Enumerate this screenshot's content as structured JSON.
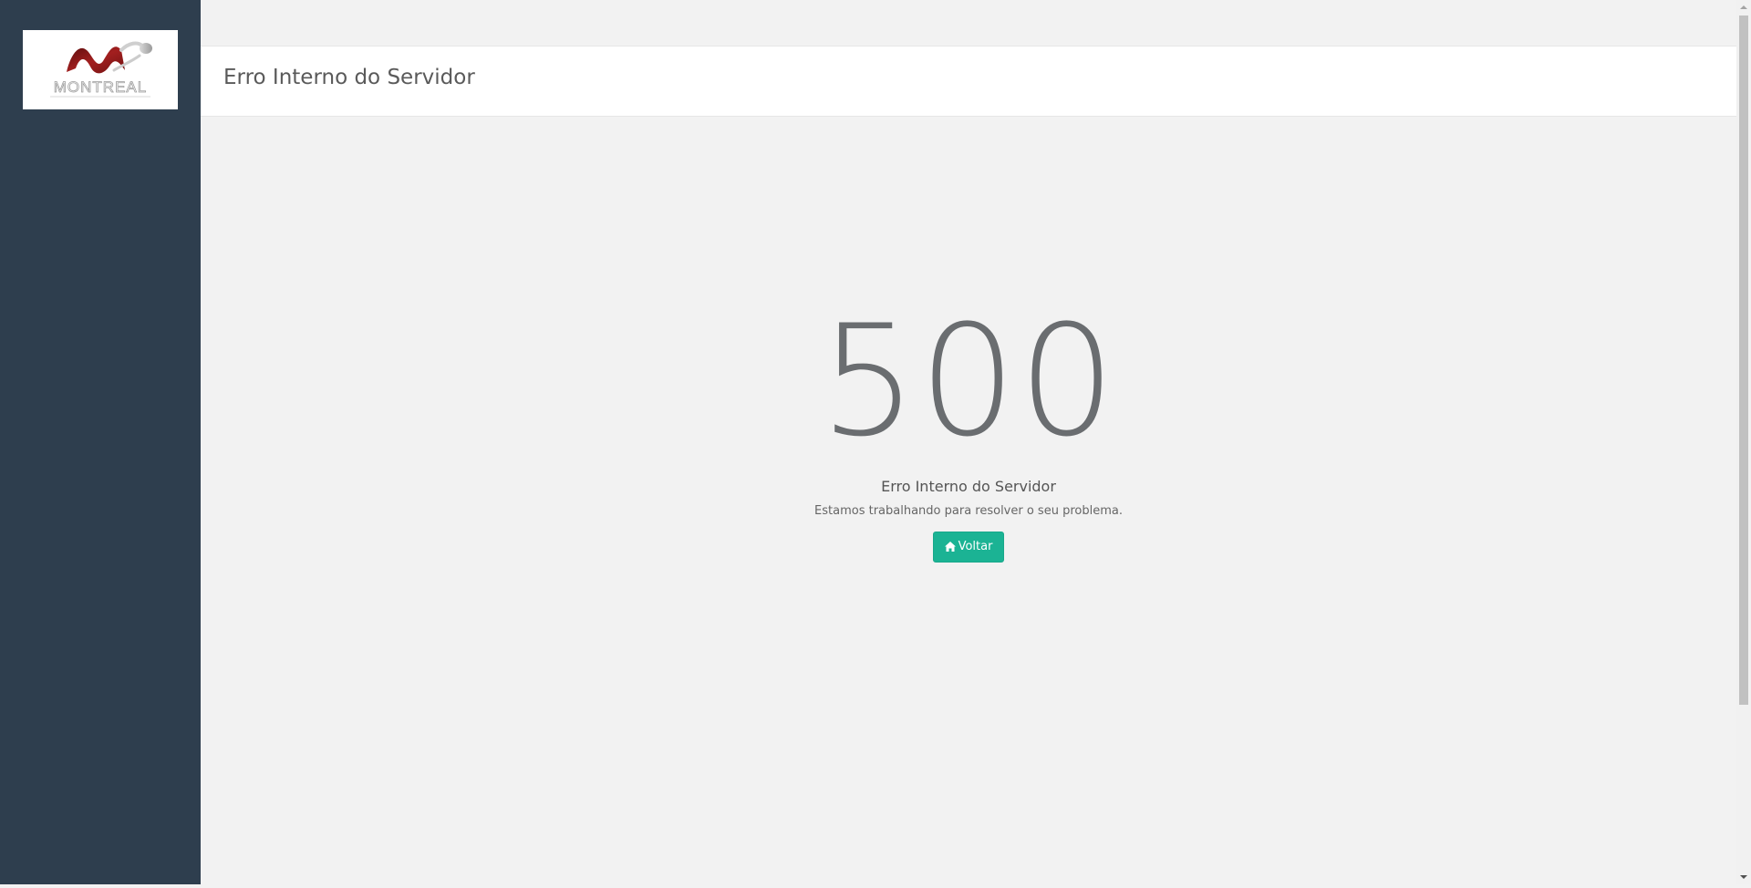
{
  "sidebar": {
    "logo": {
      "icon": "montreal-logo",
      "text": "MONTREAL",
      "colors": {
        "primary": "#8b1a1a",
        "secondary": "#b8b8b8"
      }
    }
  },
  "header": {
    "title": "Erro Interno do Servidor"
  },
  "error": {
    "code": "500",
    "heading": "Erro Interno do Servidor",
    "message": "Estamos trabalhando para resolver o seu problema.",
    "back_button": {
      "label": "Voltar",
      "icon": "home-icon"
    }
  },
  "colors": {
    "sidebar_bg": "#2e3e4e",
    "accent": "#1bb394",
    "page_bg": "#f2f2f2"
  }
}
